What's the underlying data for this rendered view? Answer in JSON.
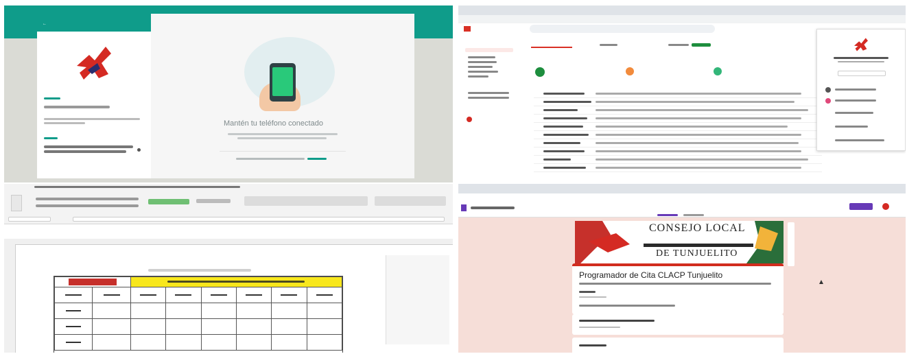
{
  "whatsapp": {
    "title": "Mantén tu teléfono conectado"
  },
  "forms": {
    "banner_line1": "CONSEJO LOCAL",
    "banner_line2": "DE TUNJUELITO",
    "form_title": "Programador de Cita CLACP Tunjuelito"
  },
  "colors": {
    "whatsapp_teal": "#0f9c8a",
    "excel_green": "#217346",
    "table_header_yellow": "#f8e71c",
    "forms_red": "#d12c1e",
    "forms_background": "#f6ded8"
  }
}
